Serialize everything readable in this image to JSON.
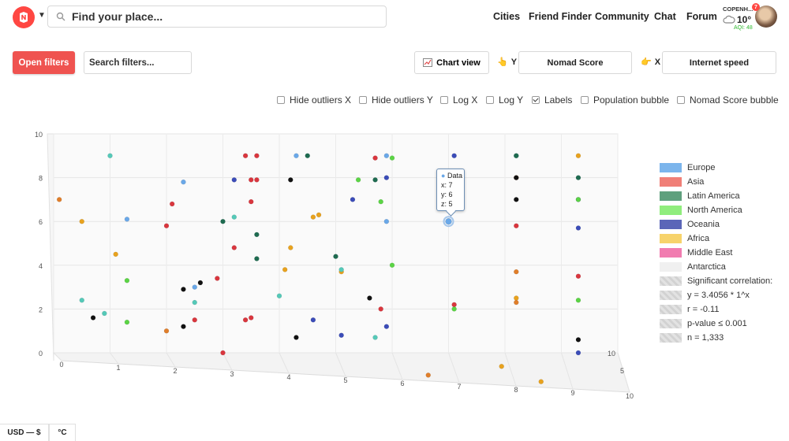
{
  "header": {
    "search_placeholder": "Find your place...",
    "nav": [
      "Cities",
      "Friend Finder",
      "Community",
      "Chat",
      "Forum"
    ],
    "city": "COPENH...",
    "temperature": "10°",
    "aqi": "AQI: 48",
    "notification_count": "7",
    "brand_color": "#ff4742"
  },
  "filters": {
    "open_label": "Open filters",
    "search_placeholder": "Search filters...",
    "chart_view_label": "Chart view",
    "y_axis_label": "Y",
    "y_axis_value": "Nomad Score",
    "x_axis_label": "X",
    "x_axis_value": "Internet speed"
  },
  "options": [
    {
      "label": "Hide outliers X",
      "checked": false
    },
    {
      "label": "Hide outliers Y",
      "checked": false
    },
    {
      "label": "Log X",
      "checked": false
    },
    {
      "label": "Log Y",
      "checked": false
    },
    {
      "label": "Labels",
      "checked": true
    },
    {
      "label": "Population bubble",
      "checked": false
    },
    {
      "label": "Nomad Score bubble",
      "checked": false
    }
  ],
  "tooltip": {
    "series": "Data",
    "x": "x: 7",
    "y": "y: 6",
    "z": "z: 5"
  },
  "legend": [
    {
      "name": "Europe",
      "color": "#7cb5ec"
    },
    {
      "name": "Asia",
      "color": "#f07f77"
    },
    {
      "name": "Latin America",
      "color": "#5fa07d"
    },
    {
      "name": "North America",
      "color": "#90ed7d"
    },
    {
      "name": "Oceania",
      "color": "#5b66b8"
    },
    {
      "name": "Africa",
      "color": "#f7d36b"
    },
    {
      "name": "Middle East",
      "color": "#f17cb0"
    },
    {
      "name": "Antarctica",
      "color": "#f0f0f0"
    }
  ],
  "stats": {
    "title": "Significant correlation:",
    "equation": "y = 3.4056 * 1^x",
    "r": "r = -0.11",
    "p": "p-value ≤ 0.001",
    "n": "n = 1,333"
  },
  "footer": {
    "currency": "USD — $",
    "units": "°C"
  },
  "chart_data": {
    "type": "scatter",
    "axes": {
      "x_range": [
        0,
        10
      ],
      "y_range": [
        0,
        10
      ],
      "z_range": [
        0,
        10
      ]
    },
    "y_ticks": [
      "0",
      "2",
      "4",
      "6",
      "8",
      "10"
    ],
    "x_ticks": [
      "0",
      "1",
      "2",
      "3",
      "4",
      "5",
      "6",
      "7",
      "8",
      "9",
      "10"
    ],
    "z_ticks": [
      "10",
      "5"
    ],
    "grid": true,
    "legend_position": "right",
    "series_colors": {
      "Europe": "#6aa8e8",
      "Asia": "#d9363e",
      "Latin America": "#1e6b50",
      "North America": "#5bd445",
      "Oceania": "#3b4cb8",
      "Africa": "#e8a21e",
      "Middle East": "#e8357d",
      "Black": "#111111",
      "Teal": "#55c9b8",
      "Orange": "#e07e2a"
    },
    "points": [
      {
        "x": 1.0,
        "y": 9.0,
        "z": 8,
        "c": "Teal"
      },
      {
        "x": 0.1,
        "y": 7.0,
        "z": 8,
        "c": "Orange"
      },
      {
        "x": 0.5,
        "y": 6.0,
        "z": 8,
        "c": "Africa"
      },
      {
        "x": 1.3,
        "y": 6.1,
        "z": 8,
        "c": "Europe"
      },
      {
        "x": 1.1,
        "y": 4.5,
        "z": 8,
        "c": "Africa"
      },
      {
        "x": 1.3,
        "y": 3.3,
        "z": 8,
        "c": "North America"
      },
      {
        "x": 0.5,
        "y": 2.4,
        "z": 8,
        "c": "Teal"
      },
      {
        "x": 0.7,
        "y": 1.6,
        "z": 8,
        "c": "Black"
      },
      {
        "x": 0.9,
        "y": 1.8,
        "z": 8,
        "c": "Teal"
      },
      {
        "x": 1.3,
        "y": 1.4,
        "z": 8,
        "c": "North America"
      },
      {
        "x": 2.3,
        "y": 7.8,
        "z": 8,
        "c": "Europe"
      },
      {
        "x": 2.1,
        "y": 6.8,
        "z": 8,
        "c": "Asia"
      },
      {
        "x": 2.0,
        "y": 5.8,
        "z": 8,
        "c": "Asia"
      },
      {
        "x": 2.3,
        "y": 2.9,
        "z": 8,
        "c": "Black"
      },
      {
        "x": 2.5,
        "y": 3.0,
        "z": 8,
        "c": "Europe"
      },
      {
        "x": 2.6,
        "y": 3.2,
        "z": 8,
        "c": "Black"
      },
      {
        "x": 2.9,
        "y": 3.4,
        "z": 8,
        "c": "Asia"
      },
      {
        "x": 2.5,
        "y": 2.3,
        "z": 8,
        "c": "Teal"
      },
      {
        "x": 2.3,
        "y": 1.2,
        "z": 8,
        "c": "Black"
      },
      {
        "x": 2.5,
        "y": 1.5,
        "z": 8,
        "c": "Asia"
      },
      {
        "x": 2.0,
        "y": 1.0,
        "z": 8,
        "c": "Orange"
      },
      {
        "x": 3.4,
        "y": 9.0,
        "z": 8,
        "c": "Asia"
      },
      {
        "x": 3.6,
        "y": 9.0,
        "z": 8,
        "c": "Asia"
      },
      {
        "x": 3.2,
        "y": 7.9,
        "z": 8,
        "c": "Oceania"
      },
      {
        "x": 3.5,
        "y": 7.9,
        "z": 8,
        "c": "Asia"
      },
      {
        "x": 3.6,
        "y": 7.9,
        "z": 8,
        "c": "Asia"
      },
      {
        "x": 3.5,
        "y": 6.9,
        "z": 8,
        "c": "Asia"
      },
      {
        "x": 3.2,
        "y": 6.2,
        "z": 8,
        "c": "Teal"
      },
      {
        "x": 3.0,
        "y": 6.0,
        "z": 8,
        "c": "Latin America"
      },
      {
        "x": 3.6,
        "y": 5.4,
        "z": 8,
        "c": "Latin America"
      },
      {
        "x": 3.2,
        "y": 4.8,
        "z": 8,
        "c": "Asia"
      },
      {
        "x": 3.6,
        "y": 4.3,
        "z": 8,
        "c": "Latin America"
      },
      {
        "x": 3.4,
        "y": 1.5,
        "z": 8,
        "c": "Asia"
      },
      {
        "x": 3.5,
        "y": 1.6,
        "z": 8,
        "c": "Asia"
      },
      {
        "x": 3.0,
        "y": 0.0,
        "z": 8,
        "c": "Asia"
      },
      {
        "x": 4.3,
        "y": 9.0,
        "z": 8,
        "c": "Europe"
      },
      {
        "x": 4.5,
        "y": 9.0,
        "z": 8,
        "c": "Latin America"
      },
      {
        "x": 4.2,
        "y": 7.9,
        "z": 8,
        "c": "Black"
      },
      {
        "x": 4.6,
        "y": 6.2,
        "z": 8,
        "c": "Africa"
      },
      {
        "x": 4.7,
        "y": 6.3,
        "z": 8,
        "c": "Africa"
      },
      {
        "x": 4.2,
        "y": 4.8,
        "z": 8,
        "c": "Africa"
      },
      {
        "x": 4.1,
        "y": 3.8,
        "z": 8,
        "c": "Africa"
      },
      {
        "x": 4.0,
        "y": 2.6,
        "z": 8,
        "c": "Teal"
      },
      {
        "x": 4.6,
        "y": 1.5,
        "z": 8,
        "c": "Oceania"
      },
      {
        "x": 4.3,
        "y": 0.7,
        "z": 8,
        "c": "Black"
      },
      {
        "x": 5.4,
        "y": 7.9,
        "z": 8,
        "c": "North America"
      },
      {
        "x": 5.3,
        "y": 7.0,
        "z": 8,
        "c": "Oceania"
      },
      {
        "x": 5.0,
        "y": 4.4,
        "z": 8,
        "c": "Latin America"
      },
      {
        "x": 5.1,
        "y": 3.7,
        "z": 8,
        "c": "Africa"
      },
      {
        "x": 5.1,
        "y": 3.8,
        "z": 8,
        "c": "Teal"
      },
      {
        "x": 5.1,
        "y": 0.8,
        "z": 8,
        "c": "Oceania"
      },
      {
        "x": 5.7,
        "y": 8.9,
        "z": 8,
        "c": "Asia"
      },
      {
        "x": 5.9,
        "y": 9.0,
        "z": 8,
        "c": "Europe"
      },
      {
        "x": 6.0,
        "y": 8.9,
        "z": 8,
        "c": "North America"
      },
      {
        "x": 5.7,
        "y": 7.9,
        "z": 8,
        "c": "Latin America"
      },
      {
        "x": 5.9,
        "y": 8.0,
        "z": 8,
        "c": "Oceania"
      },
      {
        "x": 5.8,
        "y": 6.9,
        "z": 8,
        "c": "North America"
      },
      {
        "x": 5.9,
        "y": 6.0,
        "z": 8,
        "c": "Europe"
      },
      {
        "x": 6.0,
        "y": 4.0,
        "z": 8,
        "c": "North America"
      },
      {
        "x": 5.6,
        "y": 2.5,
        "z": 8,
        "c": "Black"
      },
      {
        "x": 5.8,
        "y": 2.0,
        "z": 8,
        "c": "Asia"
      },
      {
        "x": 5.9,
        "y": 1.2,
        "z": 8,
        "c": "Oceania"
      },
      {
        "x": 5.7,
        "y": 0.7,
        "z": 8,
        "c": "Teal"
      },
      {
        "x": 7.1,
        "y": 9.0,
        "z": 8,
        "c": "Oceania"
      },
      {
        "x": 7.1,
        "y": 2.2,
        "z": 8,
        "c": "Asia"
      },
      {
        "x": 7.1,
        "y": 2.0,
        "z": 8,
        "c": "North America"
      },
      {
        "x": 8.2,
        "y": 9.0,
        "z": 8,
        "c": "Teal"
      },
      {
        "x": 8.2,
        "y": 9.0,
        "z": 8,
        "c": "Latin America"
      },
      {
        "x": 8.2,
        "y": 8.0,
        "z": 8,
        "c": "Orange"
      },
      {
        "x": 8.2,
        "y": 8.0,
        "z": 8,
        "c": "Black"
      },
      {
        "x": 8.2,
        "y": 7.0,
        "z": 8,
        "c": "Black"
      },
      {
        "x": 8.2,
        "y": 5.8,
        "z": 8,
        "c": "Asia"
      },
      {
        "x": 8.2,
        "y": 3.7,
        "z": 8,
        "c": "Orange"
      },
      {
        "x": 8.2,
        "y": 2.5,
        "z": 8,
        "c": "Africa"
      },
      {
        "x": 8.2,
        "y": 2.3,
        "z": 8,
        "c": "Orange"
      },
      {
        "x": 9.3,
        "y": 9.0,
        "z": 8,
        "c": "Africa"
      },
      {
        "x": 9.3,
        "y": 8.0,
        "z": 8,
        "c": "Latin America"
      },
      {
        "x": 9.3,
        "y": 7.0,
        "z": 8,
        "c": "Oceania"
      },
      {
        "x": 9.3,
        "y": 7.0,
        "z": 8,
        "c": "North America"
      },
      {
        "x": 9.3,
        "y": 5.7,
        "z": 8,
        "c": "Oceania"
      },
      {
        "x": 9.3,
        "y": 3.5,
        "z": 8,
        "c": "Asia"
      },
      {
        "x": 9.3,
        "y": 2.4,
        "z": 8,
        "c": "North America"
      },
      {
        "x": 9.3,
        "y": 0.6,
        "z": 8,
        "c": "Black"
      },
      {
        "x": 9.3,
        "y": 0.0,
        "z": 8,
        "c": "Oceania"
      },
      {
        "x": 7.8,
        "y": 0.1,
        "z": 3,
        "c": "Africa"
      },
      {
        "x": 8.5,
        "y": -0.6,
        "z": 3,
        "c": "Africa"
      },
      {
        "x": 6.5,
        "y": -0.3,
        "z": 3,
        "c": "Orange"
      },
      {
        "x": 7.0,
        "y": 6.0,
        "z": 5,
        "c": "Europe",
        "highlight": true
      }
    ]
  }
}
